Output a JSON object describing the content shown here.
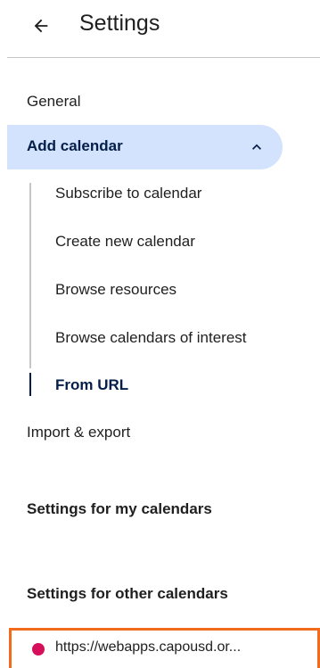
{
  "header": {
    "title": "Settings",
    "back_icon": "arrow-back-icon"
  },
  "nav": {
    "general": "General",
    "add_calendar": {
      "label": "Add calendar",
      "expanded": true,
      "items": [
        "Subscribe to calendar",
        "Create new calendar",
        "Browse resources",
        "Browse calendars of interest",
        "From URL"
      ],
      "active_item": "From URL"
    },
    "import_export": "Import & export",
    "my_calendars_heading": "Settings for my calendars",
    "other_calendars_heading": "Settings for other calendars",
    "other_calendars": [
      {
        "name": "https://webapps.capousd.or...",
        "color": "#d50f5b"
      }
    ]
  },
  "colors": {
    "selected_bg": "#d3e3fd",
    "selected_text": "#041e49",
    "highlight_border": "#f26b1d"
  }
}
